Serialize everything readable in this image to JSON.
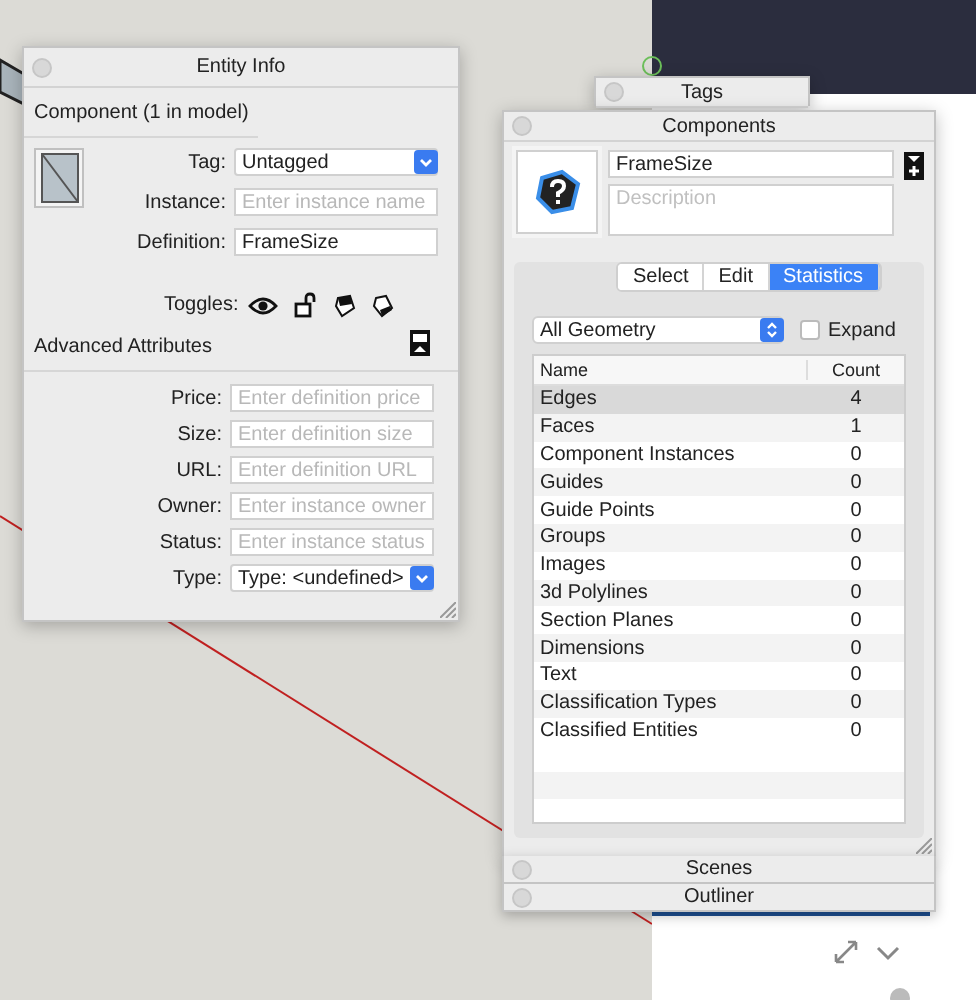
{
  "entity_info": {
    "title": "Entity Info",
    "header": "Component (1 in model)",
    "fields": [
      {
        "label": "Tag:",
        "kind": "select",
        "value": "Untagged"
      },
      {
        "label": "Instance:",
        "kind": "text",
        "placeholder": "Enter instance name"
      },
      {
        "label": "Definition:",
        "kind": "text",
        "value": "FrameSize"
      }
    ],
    "toggles_label": "Toggles:",
    "advanced_title": "Advanced Attributes",
    "advanced_fields": [
      {
        "label": "Price:",
        "kind": "text",
        "placeholder": "Enter definition price"
      },
      {
        "label": "Size:",
        "kind": "text",
        "placeholder": "Enter definition size"
      },
      {
        "label": "URL:",
        "kind": "text",
        "placeholder": "Enter definition URL"
      },
      {
        "label": "Owner:",
        "kind": "text",
        "placeholder": "Enter instance owner"
      },
      {
        "label": "Status:",
        "kind": "text",
        "placeholder": "Enter instance status"
      },
      {
        "label": "Type:",
        "kind": "select",
        "value": "Type: <undefined>"
      }
    ]
  },
  "tags_panel": {
    "title": "Tags"
  },
  "components": {
    "title": "Components",
    "name_value": "FrameSize",
    "description_placeholder": "Description",
    "tabs": [
      {
        "label": "Select",
        "selected": false
      },
      {
        "label": "Edit",
        "selected": false
      },
      {
        "label": "Statistics",
        "selected": true
      }
    ],
    "filter": {
      "value": "All Geometry"
    },
    "expand": {
      "label": "Expand",
      "checked": false
    },
    "table": {
      "columns": [
        "Name",
        "Count"
      ],
      "rows": [
        {
          "name": "Edges",
          "count": "4",
          "selected": true
        },
        {
          "name": "Faces",
          "count": "1",
          "selected": false
        },
        {
          "name": "Component Instances",
          "count": "0",
          "selected": false
        },
        {
          "name": "Guides",
          "count": "0",
          "selected": false
        },
        {
          "name": "Guide Points",
          "count": "0",
          "selected": false
        },
        {
          "name": "Groups",
          "count": "0",
          "selected": false
        },
        {
          "name": "Images",
          "count": "0",
          "selected": false
        },
        {
          "name": "3d Polylines",
          "count": "0",
          "selected": false
        },
        {
          "name": "Section Planes",
          "count": "0",
          "selected": false
        },
        {
          "name": "Dimensions",
          "count": "0",
          "selected": false
        },
        {
          "name": "Text",
          "count": "0",
          "selected": false
        },
        {
          "name": "Classification Types",
          "count": "0",
          "selected": false
        },
        {
          "name": "Classified Entities",
          "count": "0",
          "selected": false
        }
      ]
    }
  },
  "collapsed_panels": [
    {
      "title": "Scenes"
    },
    {
      "title": "Outliner"
    }
  ]
}
